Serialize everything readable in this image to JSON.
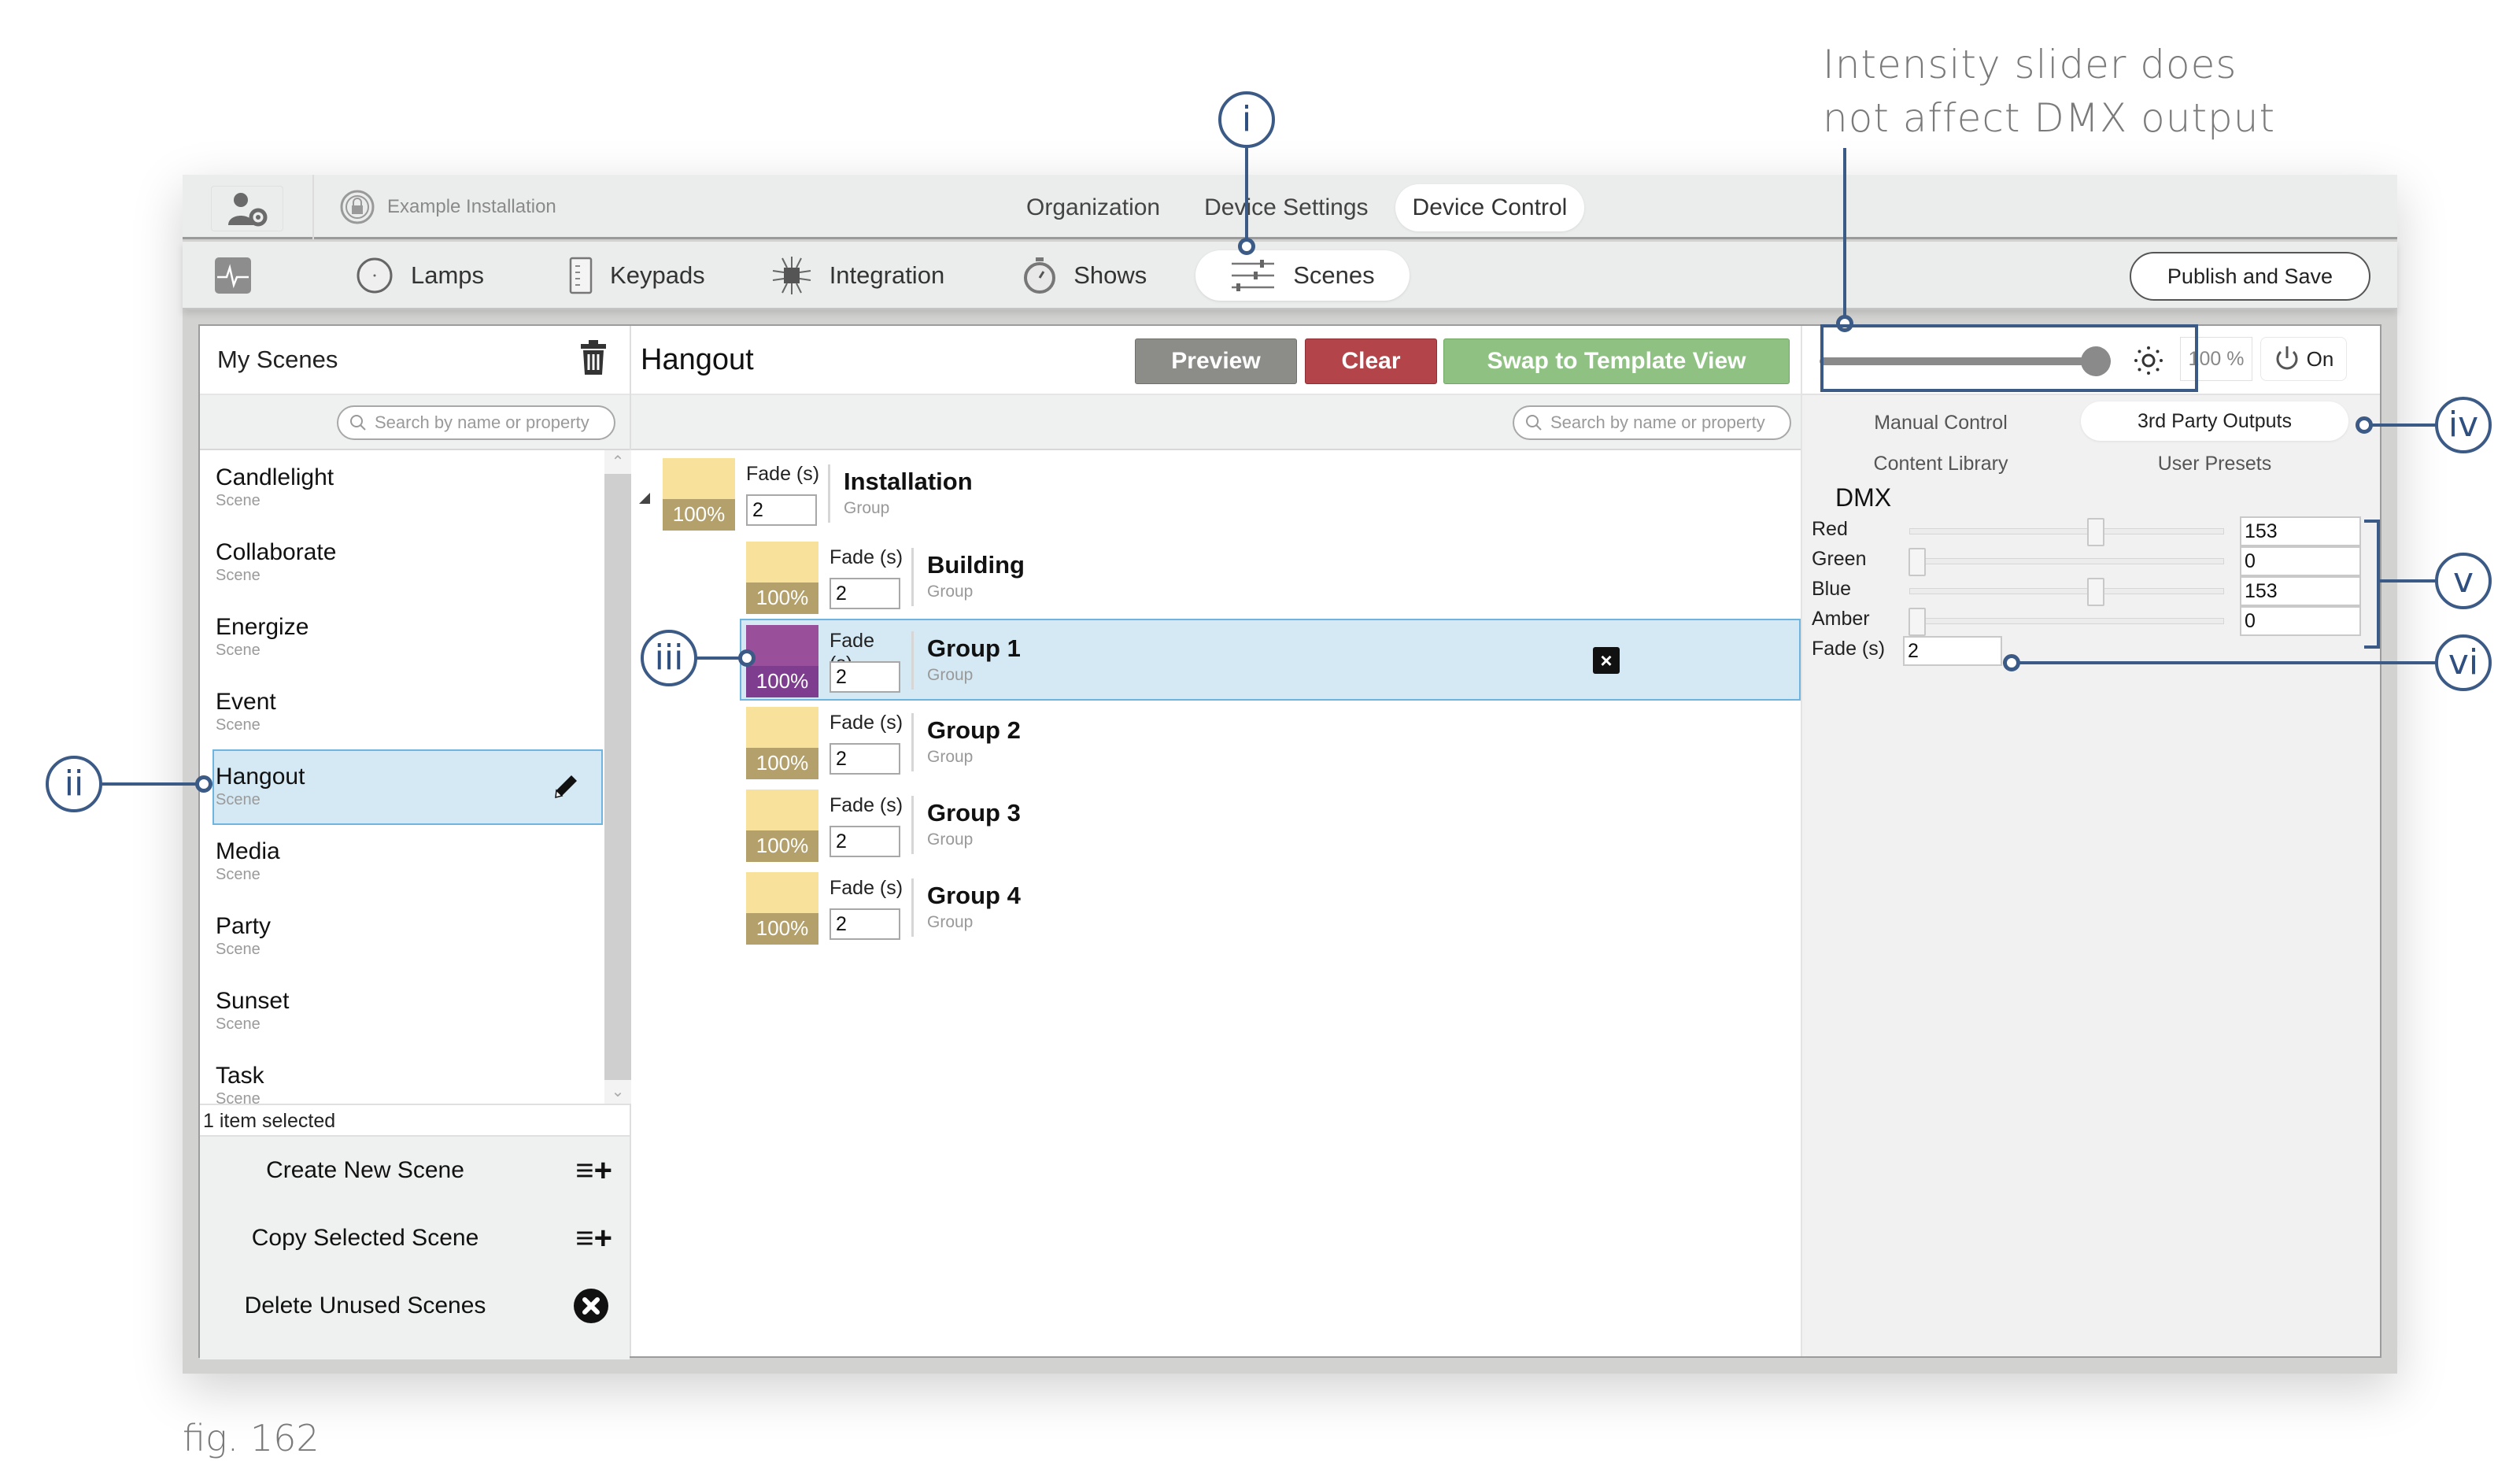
{
  "annotation": {
    "note_line1": "Intensity slider does",
    "note_line2": "not affect DMX output",
    "callouts": [
      "i",
      "ii",
      "iii",
      "iv",
      "v",
      "vi"
    ],
    "figure_caption": "fig. 162"
  },
  "topbar": {
    "user_settings_icon": "user-gear-icon",
    "installation_icon": "lock-circle-icon",
    "installation_name": "Example Installation",
    "tabs": [
      {
        "label": "Organization",
        "active": false
      },
      {
        "label": "Device Settings",
        "active": false
      },
      {
        "label": "Device Control",
        "active": true
      }
    ]
  },
  "navbar": {
    "items": [
      {
        "label": "",
        "icon": "activity-monitor-icon",
        "active": false
      },
      {
        "label": "Lamps",
        "icon": "lamp-circle-icon",
        "active": false
      },
      {
        "label": "Keypads",
        "icon": "keypad-icon",
        "active": false
      },
      {
        "label": "Integration",
        "icon": "integration-chip-icon",
        "active": false
      },
      {
        "label": "Shows",
        "icon": "stopwatch-icon",
        "active": false
      },
      {
        "label": "Scenes",
        "icon": "sliders-icon",
        "active": true
      }
    ],
    "publish_label": "Publish and Save"
  },
  "left_panel": {
    "title": "My Scenes",
    "search_placeholder": "Search by name or property",
    "scenes": [
      {
        "name": "Candlelight",
        "type": "Scene"
      },
      {
        "name": "Collaborate",
        "type": "Scene"
      },
      {
        "name": "Energize",
        "type": "Scene"
      },
      {
        "name": "Event",
        "type": "Scene"
      },
      {
        "name": "Hangout",
        "type": "Scene",
        "selected": true
      },
      {
        "name": "Media",
        "type": "Scene"
      },
      {
        "name": "Party",
        "type": "Scene"
      },
      {
        "name": "Sunset",
        "type": "Scene"
      },
      {
        "name": "Task",
        "type": "Scene"
      }
    ],
    "status": "1 item selected",
    "actions": [
      {
        "label": "Create New Scene",
        "icon": "list-add-icon"
      },
      {
        "label": "Copy Selected Scene",
        "icon": "list-add-icon"
      },
      {
        "label": "Delete Unused Scenes",
        "icon": "circle-x-icon"
      }
    ]
  },
  "center_panel": {
    "title": "Hangout",
    "buttons": {
      "preview": "Preview",
      "clear": "Clear",
      "swap": "Swap to Template View"
    },
    "search_placeholder": "Search by name or property",
    "fade_label": "Fade (s)",
    "groups": [
      {
        "name": "Installation",
        "type": "Group",
        "intensity": "100%",
        "fade": "2",
        "color": "#f8e29b",
        "shade": "#b3a06b",
        "level": 0,
        "expanded": true
      },
      {
        "name": "Building",
        "type": "Group",
        "intensity": "100%",
        "fade": "2",
        "color": "#f8e29b",
        "shade": "#b3a06b",
        "level": 1
      },
      {
        "name": "Group 1",
        "type": "Group",
        "intensity": "100%",
        "fade": "2",
        "color": "#9a4f9a",
        "shade": "#7e3d8e",
        "level": 1,
        "selected": true
      },
      {
        "name": "Group 2",
        "type": "Group",
        "intensity": "100%",
        "fade": "2",
        "color": "#f8e29b",
        "shade": "#b3a06b",
        "level": 1
      },
      {
        "name": "Group 3",
        "type": "Group",
        "intensity": "100%",
        "fade": "2",
        "color": "#f8e29b",
        "shade": "#b3a06b",
        "level": 1
      },
      {
        "name": "Group 4",
        "type": "Group",
        "intensity": "100%",
        "fade": "2",
        "color": "#f8e29b",
        "shade": "#b3a06b",
        "level": 1
      }
    ]
  },
  "right_panel": {
    "intensity_percent": 100,
    "intensity_label": "100 %",
    "power_label": "On",
    "tabs": [
      {
        "label": "Manual Control",
        "active": false
      },
      {
        "label": "3rd Party Outputs",
        "active": true
      },
      {
        "label": "Content Library",
        "active": false
      },
      {
        "label": "User Presets",
        "active": false
      }
    ],
    "dmx": {
      "title": "DMX",
      "channels": [
        {
          "label": "Red",
          "value": "153",
          "fraction": 0.6
        },
        {
          "label": "Green",
          "value": "0",
          "fraction": 0
        },
        {
          "label": "Blue",
          "value": "153",
          "fraction": 0.6
        },
        {
          "label": "Amber",
          "value": "0",
          "fraction": 0
        }
      ],
      "fade_label": "Fade (s)",
      "fade_value": "2"
    }
  },
  "colors": {
    "annotation": "#3b5a86",
    "selection_bg": "#d5e9f5",
    "selection_border": "#6fb3df",
    "preview": "#8c8c88",
    "clear": "#b3444a",
    "swap": "#8fc282"
  }
}
